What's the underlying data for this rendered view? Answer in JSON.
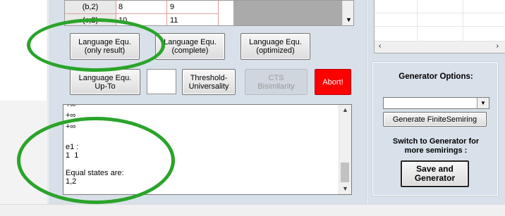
{
  "grid": {
    "rows": [
      {
        "header": "(b,2)",
        "col1": "8",
        "col2": "9"
      },
      {
        "header": "(c,2)",
        "col1": "10",
        "col2": "11"
      }
    ]
  },
  "buttons": {
    "lang_only_result": "Language Equ.\n(only result)",
    "lang_complete": "Language Equ.\n(complete)",
    "lang_optimized": "Language Equ.\n(optimized)",
    "lang_upto": "Language Equ.\nUp-To",
    "threshold": "Threshold-\nUniversality",
    "cts": "CTS\nBisimilarity",
    "abort": "Abort!"
  },
  "output": {
    "lines": [
      "+∞",
      "+∞",
      "+∞",
      "",
      "e1 :",
      "1  1",
      "",
      "Equal states are:",
      "1,2"
    ]
  },
  "generator": {
    "title": "Generator Options:",
    "select_value": "",
    "generate_button": "Generate FiniteSemiring",
    "switch_text": "Switch to Generator for\nmore semirings :",
    "save_button": "Save and\nGenerator"
  },
  "colors": {
    "panel": "#d8e1ea",
    "abort": "#ff0000",
    "annotation": "#2aa42a"
  },
  "icons": {
    "scroll_up": "chevron-up-icon",
    "scroll_down": "chevron-down-icon",
    "scroll_left": "chevron-left-icon",
    "scroll_right": "chevron-right-icon",
    "dropdown": "chevron-down-icon"
  }
}
